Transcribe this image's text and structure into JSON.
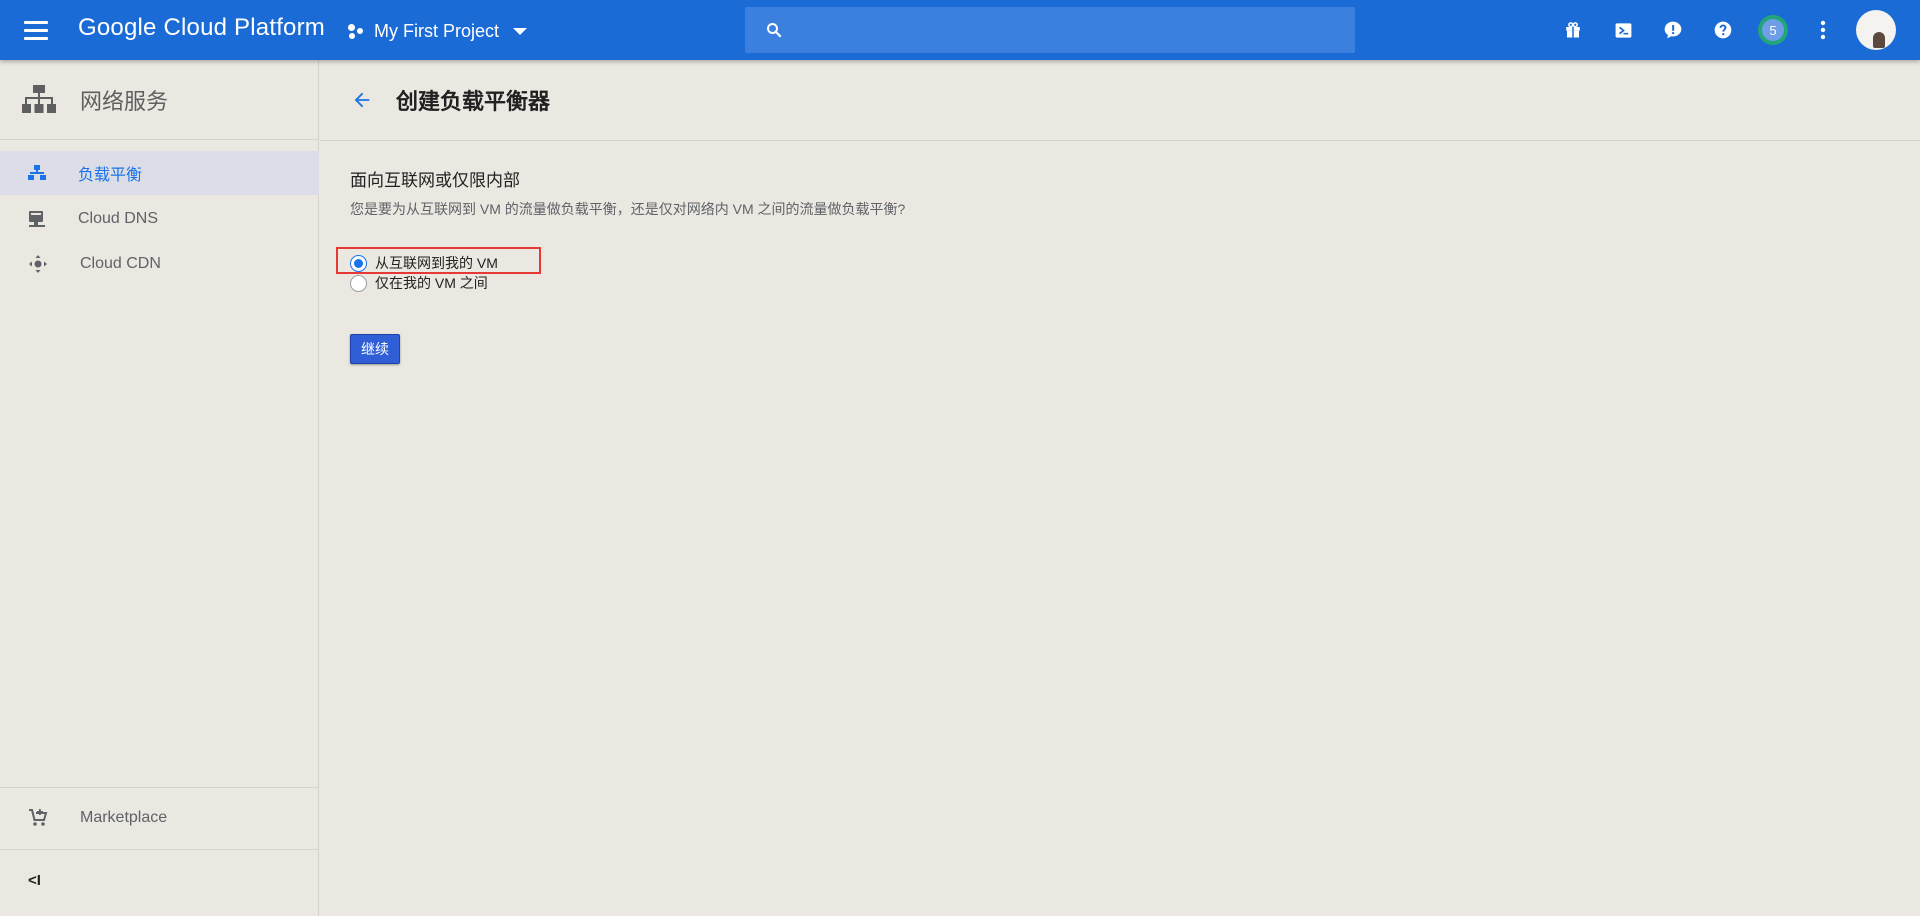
{
  "topbar": {
    "brand": "Google Cloud Platform",
    "project_name": "My First Project",
    "search_placeholder": "",
    "notification_count": "5"
  },
  "sidebar": {
    "title": "网络服务",
    "items": [
      {
        "label": "负载平衡",
        "active": true
      },
      {
        "label": "Cloud DNS",
        "active": false
      },
      {
        "label": "Cloud CDN",
        "active": false
      }
    ],
    "marketplace_label": "Marketplace",
    "collapse_label": "<I"
  },
  "main": {
    "title": "创建负载平衡器",
    "section_heading": "面向互联网或仅限内部",
    "section_desc": "您是要为从互联网到 VM 的流量做负载平衡，还是仅对网络内 VM 之间的流量做负载平衡?",
    "options": [
      {
        "label": "从互联网到我的 VM",
        "checked": true
      },
      {
        "label": "仅在我的 VM 之间",
        "checked": false
      }
    ],
    "continue_label": "继续"
  },
  "colors": {
    "topbar": "#1a6bd6",
    "accent": "#1a73e8",
    "background": "#ebe7e1",
    "highlight": "#e53935"
  }
}
